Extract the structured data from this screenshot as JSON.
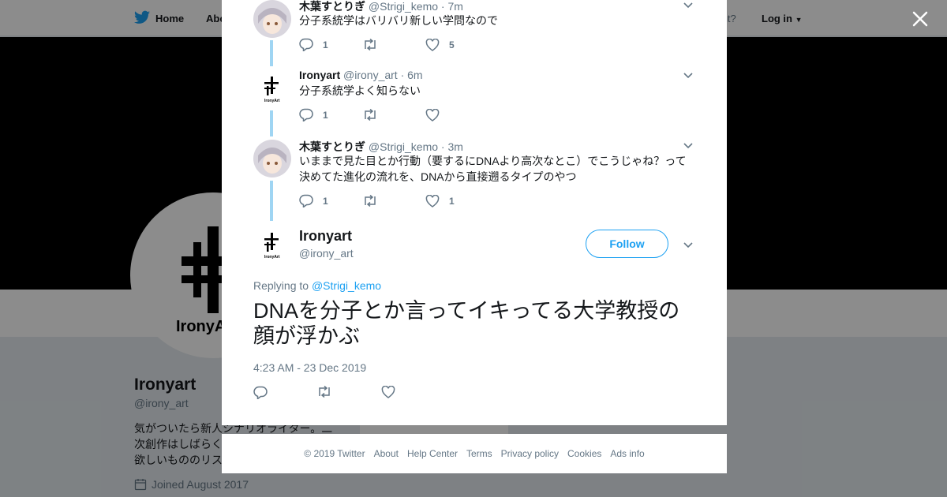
{
  "topbar": {
    "home_label": "Home",
    "about_label": "Abo",
    "have_account": "account?",
    "login_label": "Log in"
  },
  "profile": {
    "logo_text": "IronyArt",
    "name": "Ironyart",
    "handle": "@irony_art",
    "bio_lines": [
      "気がついたら新人シナリオライター。二",
      "次創作はしばらく",
      "欲しいもののリス"
    ],
    "joined": "Joined August 2017",
    "card_text": "Ads info"
  },
  "thread": [
    {
      "name": "木葉すとりぎ",
      "handle": "@Strigi_kemo",
      "time": "· 7m",
      "text": "分子系統学はバリバリ新しい学問なので",
      "replies": "1",
      "retweets": "",
      "likes": "5"
    },
    {
      "name": "Ironyart",
      "handle": "@irony_art",
      "time": "· 6m",
      "text": "分子系統学よく知らない",
      "replies": "1",
      "retweets": "",
      "likes": ""
    },
    {
      "name": "木葉すとりぎ",
      "handle": "@Strigi_kemo",
      "time": "· 3m",
      "text": "いままで見た目とか行動（要するにDNAより高次なとこ）でこうじゃね？って決めてた進化の流れを、DNAから直接遡るタイプのやつ",
      "replies": "1",
      "retweets": "",
      "likes": "1"
    }
  ],
  "main_tweet": {
    "name": "Ironyart",
    "handle": "@irony_art",
    "follow_label": "Follow",
    "replying_prefix": "Replying to",
    "replying_to": "@Strigi_kemo",
    "text": "DNAを分子とか言ってイキってる大学教授の顔が浮かぶ",
    "date": "4:23 AM - 23 Dec 2019"
  },
  "footer": {
    "links": [
      "© 2019 Twitter",
      "About",
      "Help Center",
      "Terms",
      "Privacy policy",
      "Cookies",
      "Ads info"
    ]
  },
  "colors": {
    "accent": "#1da1f2",
    "thread_line": "#9fd5f3",
    "muted": "#657786"
  },
  "icons": [
    "twitter-bird-icon",
    "close-icon",
    "reply-icon",
    "retweet-icon",
    "like-icon",
    "chevron-down-icon",
    "calendar-icon"
  ]
}
